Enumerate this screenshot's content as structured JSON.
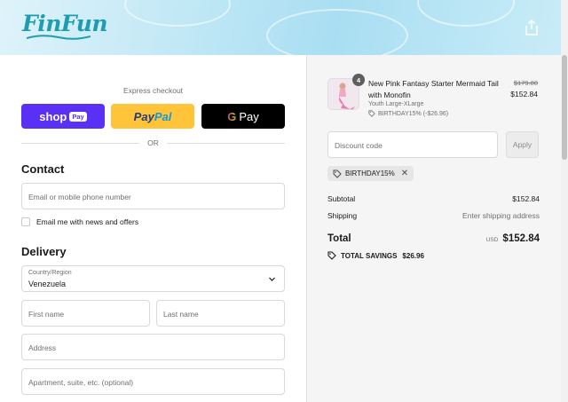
{
  "brand": {
    "logo_text": "FinFun",
    "accent": "#1f9db0"
  },
  "header": {
    "share_icon": "share-icon"
  },
  "express": {
    "label": "Express checkout",
    "shop_label": "shop",
    "shop_badge": "Pay",
    "paypal_part1": "Pay",
    "paypal_part2": "Pal",
    "gpay_g": "G",
    "gpay_label": "Pay",
    "or_label": "OR"
  },
  "contact": {
    "title": "Contact",
    "email_placeholder": "Email or mobile phone number",
    "news_label": "Email me with news and offers"
  },
  "delivery": {
    "title": "Delivery",
    "country_label": "Country/Region",
    "country_value": "Venezuela",
    "first_name_placeholder": "First name",
    "last_name_placeholder": "Last name",
    "address_placeholder": "Address",
    "apartment_placeholder": "Apartment, suite, etc. (optional)"
  },
  "summary": {
    "product": {
      "quantity": "4",
      "title": "New Pink Fantasy Starter Mermaid Tail with Monofin",
      "variant": "Youth Large-XLarge",
      "discount_note": "BIRTHDAY15% (-$26.96)",
      "old_price": "$179.80",
      "new_price": "$152.84"
    },
    "discount_placeholder": "Discount code",
    "apply_label": "Apply",
    "applied_code": "BIRTHDAY15%",
    "subtotal_label": "Subtotal",
    "subtotal_value": "$152.84",
    "shipping_label": "Shipping",
    "shipping_value": "Enter shipping address",
    "total_label": "Total",
    "total_currency": "USD",
    "total_value": "$152.84",
    "savings_label": "TOTAL SAVINGS",
    "savings_value": "$26.96"
  }
}
